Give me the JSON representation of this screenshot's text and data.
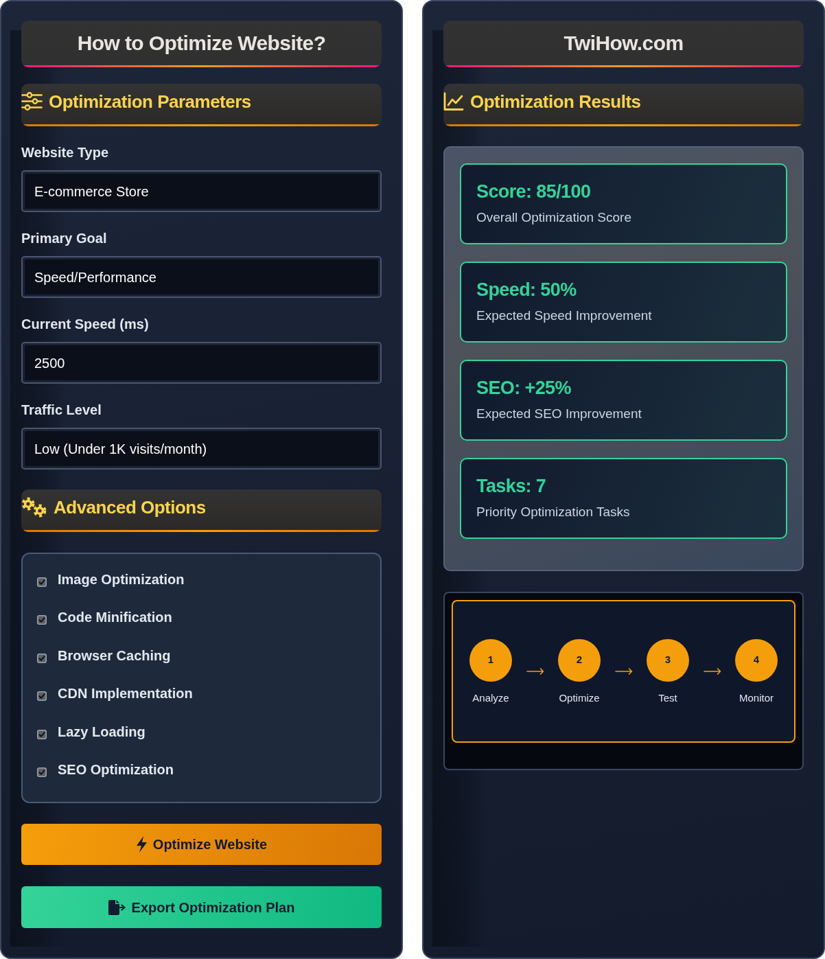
{
  "left_panel": {
    "title": "How to Optimize Website?",
    "parameters_section": {
      "title": "Optimization Parameters"
    },
    "fields": [
      {
        "label": "Website Type",
        "value": "E-commerce Store"
      },
      {
        "label": "Primary Goal",
        "value": "Speed/Performance"
      },
      {
        "label": "Current Speed (ms)",
        "value": "2500"
      },
      {
        "label": "Traffic Level",
        "value": "Low (Under 1K visits/month)"
      }
    ],
    "advanced_section": {
      "title": "Advanced Options"
    },
    "options": [
      {
        "label": "Image Optimization",
        "checked": true
      },
      {
        "label": "Code Minification",
        "checked": true
      },
      {
        "label": "Browser Caching",
        "checked": true
      },
      {
        "label": "CDN Implementation",
        "checked": true
      },
      {
        "label": "Lazy Loading",
        "checked": true
      },
      {
        "label": "SEO Optimization",
        "checked": true
      }
    ],
    "buttons": [
      {
        "label": "Optimize Website",
        "kind": "optimize"
      },
      {
        "label": "Export Optimization Plan",
        "kind": "export"
      }
    ]
  },
  "right_panel": {
    "title": "TwiHow.com",
    "results_section": {
      "title": "Optimization Results"
    },
    "results": [
      {
        "value": "Score: 85/100",
        "caption": "Overall Optimization Score"
      },
      {
        "value": "Speed: 50%",
        "caption": "Expected Speed Improvement"
      },
      {
        "value": "SEO: +25%",
        "caption": "Expected SEO Improvement"
      },
      {
        "value": "Tasks: 7",
        "caption": "Priority Optimization Tasks"
      }
    ],
    "process_steps": [
      {
        "number": "1",
        "label": "Analyze"
      },
      {
        "number": "2",
        "label": "Optimize"
      },
      {
        "number": "3",
        "label": "Test"
      },
      {
        "number": "4",
        "label": "Monitor"
      }
    ]
  }
}
